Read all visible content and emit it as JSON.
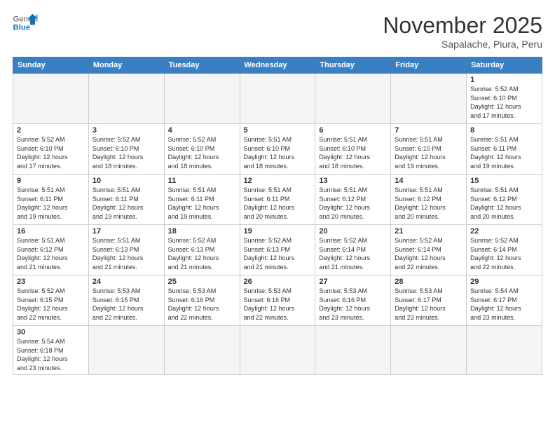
{
  "header": {
    "logo_general": "General",
    "logo_blue": "Blue",
    "month_title": "November 2025",
    "location": "Sapalache, Piura, Peru"
  },
  "weekdays": [
    "Sunday",
    "Monday",
    "Tuesday",
    "Wednesday",
    "Thursday",
    "Friday",
    "Saturday"
  ],
  "weeks": [
    [
      {
        "day": "",
        "info": ""
      },
      {
        "day": "",
        "info": ""
      },
      {
        "day": "",
        "info": ""
      },
      {
        "day": "",
        "info": ""
      },
      {
        "day": "",
        "info": ""
      },
      {
        "day": "",
        "info": ""
      },
      {
        "day": "1",
        "info": "Sunrise: 5:52 AM\nSunset: 6:10 PM\nDaylight: 12 hours\nand 17 minutes."
      }
    ],
    [
      {
        "day": "2",
        "info": "Sunrise: 5:52 AM\nSunset: 6:10 PM\nDaylight: 12 hours\nand 17 minutes."
      },
      {
        "day": "3",
        "info": "Sunrise: 5:52 AM\nSunset: 6:10 PM\nDaylight: 12 hours\nand 18 minutes."
      },
      {
        "day": "4",
        "info": "Sunrise: 5:52 AM\nSunset: 6:10 PM\nDaylight: 12 hours\nand 18 minutes."
      },
      {
        "day": "5",
        "info": "Sunrise: 5:51 AM\nSunset: 6:10 PM\nDaylight: 12 hours\nand 18 minutes."
      },
      {
        "day": "6",
        "info": "Sunrise: 5:51 AM\nSunset: 6:10 PM\nDaylight: 12 hours\nand 18 minutes."
      },
      {
        "day": "7",
        "info": "Sunrise: 5:51 AM\nSunset: 6:10 PM\nDaylight: 12 hours\nand 19 minutes."
      },
      {
        "day": "8",
        "info": "Sunrise: 5:51 AM\nSunset: 6:11 PM\nDaylight: 12 hours\nand 19 minutes."
      }
    ],
    [
      {
        "day": "9",
        "info": "Sunrise: 5:51 AM\nSunset: 6:11 PM\nDaylight: 12 hours\nand 19 minutes."
      },
      {
        "day": "10",
        "info": "Sunrise: 5:51 AM\nSunset: 6:11 PM\nDaylight: 12 hours\nand 19 minutes."
      },
      {
        "day": "11",
        "info": "Sunrise: 5:51 AM\nSunset: 6:11 PM\nDaylight: 12 hours\nand 19 minutes."
      },
      {
        "day": "12",
        "info": "Sunrise: 5:51 AM\nSunset: 6:11 PM\nDaylight: 12 hours\nand 20 minutes."
      },
      {
        "day": "13",
        "info": "Sunrise: 5:51 AM\nSunset: 6:12 PM\nDaylight: 12 hours\nand 20 minutes."
      },
      {
        "day": "14",
        "info": "Sunrise: 5:51 AM\nSunset: 6:12 PM\nDaylight: 12 hours\nand 20 minutes."
      },
      {
        "day": "15",
        "info": "Sunrise: 5:51 AM\nSunset: 6:12 PM\nDaylight: 12 hours\nand 20 minutes."
      }
    ],
    [
      {
        "day": "16",
        "info": "Sunrise: 5:51 AM\nSunset: 6:12 PM\nDaylight: 12 hours\nand 21 minutes."
      },
      {
        "day": "17",
        "info": "Sunrise: 5:51 AM\nSunset: 6:13 PM\nDaylight: 12 hours\nand 21 minutes."
      },
      {
        "day": "18",
        "info": "Sunrise: 5:52 AM\nSunset: 6:13 PM\nDaylight: 12 hours\nand 21 minutes."
      },
      {
        "day": "19",
        "info": "Sunrise: 5:52 AM\nSunset: 6:13 PM\nDaylight: 12 hours\nand 21 minutes."
      },
      {
        "day": "20",
        "info": "Sunrise: 5:52 AM\nSunset: 6:14 PM\nDaylight: 12 hours\nand 21 minutes."
      },
      {
        "day": "21",
        "info": "Sunrise: 5:52 AM\nSunset: 6:14 PM\nDaylight: 12 hours\nand 22 minutes."
      },
      {
        "day": "22",
        "info": "Sunrise: 5:52 AM\nSunset: 6:14 PM\nDaylight: 12 hours\nand 22 minutes."
      }
    ],
    [
      {
        "day": "23",
        "info": "Sunrise: 5:52 AM\nSunset: 6:15 PM\nDaylight: 12 hours\nand 22 minutes."
      },
      {
        "day": "24",
        "info": "Sunrise: 5:53 AM\nSunset: 6:15 PM\nDaylight: 12 hours\nand 22 minutes."
      },
      {
        "day": "25",
        "info": "Sunrise: 5:53 AM\nSunset: 6:16 PM\nDaylight: 12 hours\nand 22 minutes."
      },
      {
        "day": "26",
        "info": "Sunrise: 5:53 AM\nSunset: 6:16 PM\nDaylight: 12 hours\nand 22 minutes."
      },
      {
        "day": "27",
        "info": "Sunrise: 5:53 AM\nSunset: 6:16 PM\nDaylight: 12 hours\nand 23 minutes."
      },
      {
        "day": "28",
        "info": "Sunrise: 5:53 AM\nSunset: 6:17 PM\nDaylight: 12 hours\nand 23 minutes."
      },
      {
        "day": "29",
        "info": "Sunrise: 5:54 AM\nSunset: 6:17 PM\nDaylight: 12 hours\nand 23 minutes."
      }
    ],
    [
      {
        "day": "30",
        "info": "Sunrise: 5:54 AM\nSunset: 6:18 PM\nDaylight: 12 hours\nand 23 minutes."
      },
      {
        "day": "",
        "info": ""
      },
      {
        "day": "",
        "info": ""
      },
      {
        "day": "",
        "info": ""
      },
      {
        "day": "",
        "info": ""
      },
      {
        "day": "",
        "info": ""
      },
      {
        "day": "",
        "info": ""
      }
    ]
  ]
}
